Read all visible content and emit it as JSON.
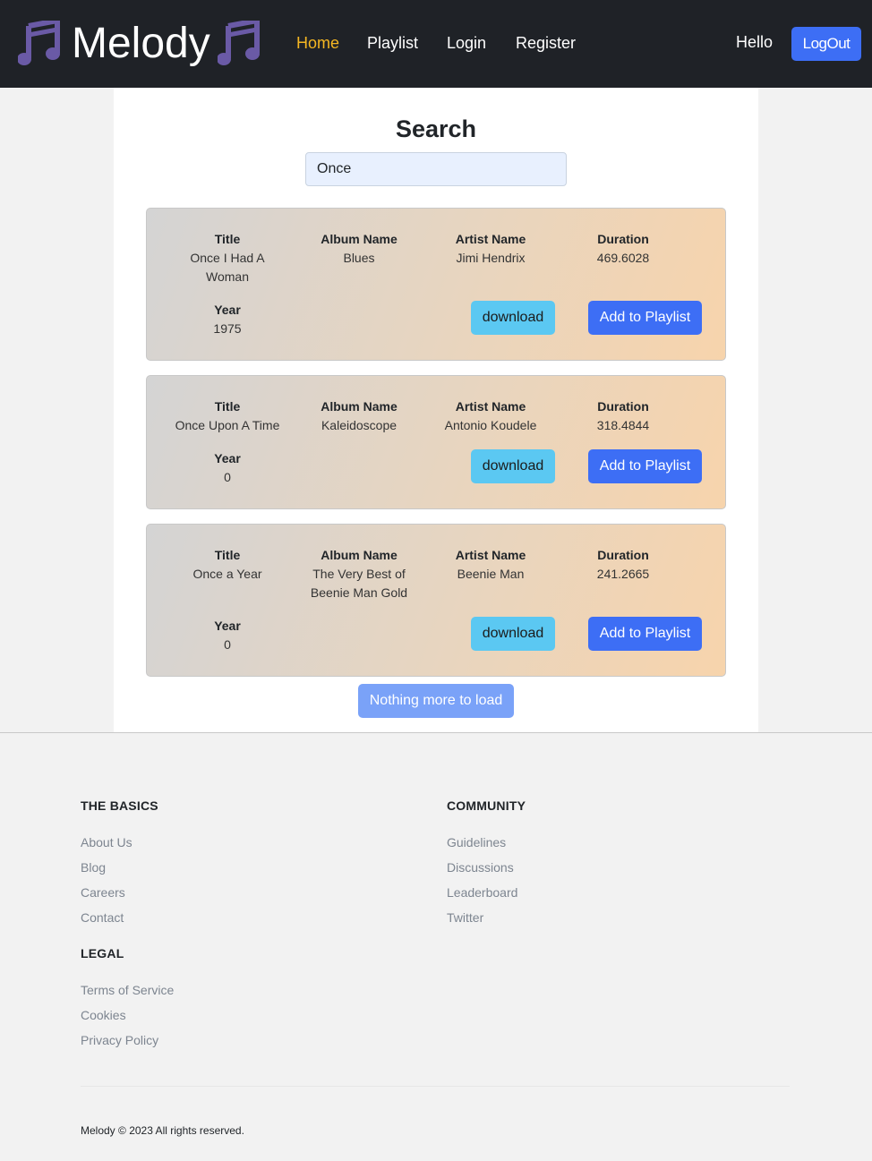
{
  "nav": {
    "brand": "Melody",
    "links": [
      "Home",
      "Playlist",
      "Login",
      "Register"
    ],
    "greeting": "Hello",
    "logout": "LogOut"
  },
  "search": {
    "title": "Search",
    "value": "Once"
  },
  "labels": {
    "title": "Title",
    "album": "Album Name",
    "artist": "Artist Name",
    "duration": "Duration",
    "year": "Year",
    "download": "download",
    "add": "Add to Playlist"
  },
  "songs": [
    {
      "title": "Once I Had A Woman",
      "album": "Blues",
      "artist": "Jimi Hendrix",
      "duration": "469.6028",
      "year": "1975"
    },
    {
      "title": "Once Upon A Time",
      "album": "Kaleidoscope",
      "artist": "Antonio Koudele",
      "duration": "318.4844",
      "year": "0"
    },
    {
      "title": "Once a Year",
      "album": "The Very Best of Beenie Man Gold",
      "artist": "Beenie Man",
      "duration": "241.2665",
      "year": "0"
    }
  ],
  "load_more": "Nothing more to load",
  "footer": {
    "basics": {
      "heading": "THE BASICS",
      "links": [
        "About Us",
        "Blog",
        "Careers",
        "Contact"
      ]
    },
    "community": {
      "heading": "COMMUNITY",
      "links": [
        "Guidelines",
        "Discussions",
        "Leaderboard",
        "Twitter"
      ]
    },
    "legal": {
      "heading": "LEGAL",
      "links": [
        "Terms of Service",
        "Cookies",
        "Privacy Policy"
      ]
    },
    "copyright": "Melody © 2023 All rights reserved."
  },
  "colors": {
    "navbar": "#1f2227",
    "active": "#f5b722",
    "primary": "#3d6ef5",
    "info": "#5bc8f2",
    "note_icon": "#6a5aa6"
  }
}
